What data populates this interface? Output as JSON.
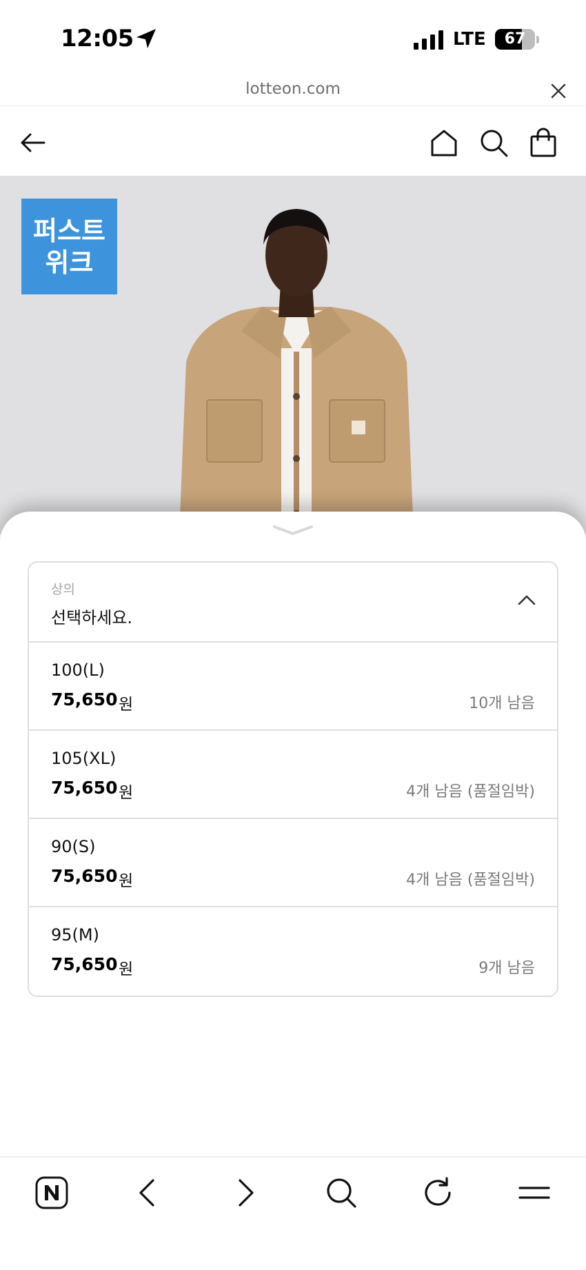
{
  "status_bar": {
    "time": "12:05",
    "network": "LTE",
    "battery": "67",
    "battery_level": 0.67
  },
  "browser": {
    "url": "lotteon.com"
  },
  "product": {
    "badge_line1": "퍼스트",
    "badge_line2": "위크"
  },
  "option_select": {
    "category": "상의",
    "placeholder": "선택하세요.",
    "currency": "원",
    "options": [
      {
        "size": "100(L)",
        "price": "75,650",
        "stock": "10개 남음"
      },
      {
        "size": "105(XL)",
        "price": "75,650",
        "stock": "4개 남음 (품절임박)"
      },
      {
        "size": "90(S)",
        "price": "75,650",
        "stock": "4개 남음 (품절임박)"
      },
      {
        "size": "95(M)",
        "price": "75,650",
        "stock": "9개 남음"
      }
    ]
  },
  "icons": {
    "header": [
      "back-arrow-icon",
      "home-icon",
      "search-icon",
      "shopping-bag-icon"
    ],
    "toolbar": [
      "naver-n-icon",
      "back-icon",
      "forward-icon",
      "search-icon",
      "refresh-icon",
      "menu-icon"
    ]
  },
  "colors": {
    "badge": "#3d94dc",
    "hero_bg": "#e0e0e2",
    "jacket": "#c7a47a"
  }
}
